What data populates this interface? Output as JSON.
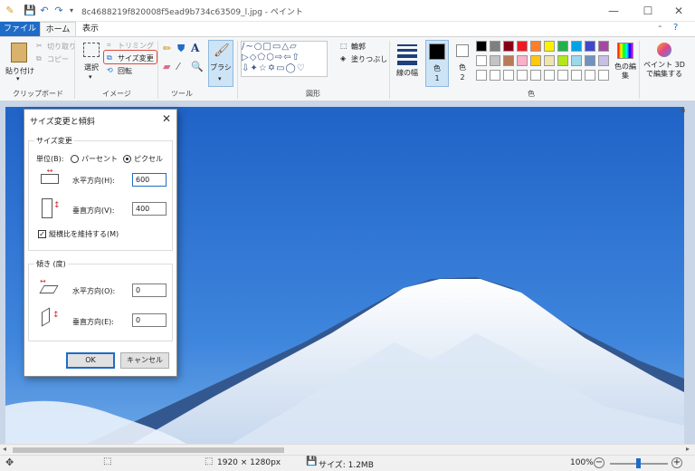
{
  "titlebar": {
    "title": "8c4688219f820008f5ead9b734c63509_l.jpg - ペイント",
    "minimize": "—",
    "maximize": "☐",
    "close": "✕"
  },
  "tabs": {
    "file": "ファイル",
    "home": "ホーム",
    "view": "表示"
  },
  "ribbon": {
    "clipboard": {
      "paste": "貼り付け",
      "cut": "切り取り",
      "copy": "コピー",
      "label": "クリップボード"
    },
    "image": {
      "select": "選択",
      "crop": "トリミング",
      "resize": "サイズ変更",
      "rotate": "回転",
      "label": "イメージ"
    },
    "tools": {
      "label": "ツール"
    },
    "brush": {
      "label": "ブラシ"
    },
    "shapes": {
      "outline": "輪郭",
      "fill": "塗りつぶし",
      "label": "図形"
    },
    "size": {
      "label": "線の幅"
    },
    "color1": {
      "label": "色",
      "num": "1"
    },
    "color2": {
      "label": "色",
      "num": "2"
    },
    "colors": {
      "label": "色"
    },
    "edit_colors": "色の編集",
    "paint3d": "ペイント 3D で編集する",
    "palette_colors": [
      "#000000",
      "#7f7f7f",
      "#880015",
      "#ed1c24",
      "#ff7f27",
      "#fff200",
      "#22b14c",
      "#00a2e8",
      "#3f48cc",
      "#a349a4",
      "#ffffff",
      "#c3c3c3",
      "#b97a57",
      "#ffaec9",
      "#ffc90e",
      "#efe4b0",
      "#b5e61d",
      "#99d9ea",
      "#7092be",
      "#c8bfe7"
    ]
  },
  "dialog": {
    "title": "サイズ変更と傾斜",
    "resize_group": "サイズ変更",
    "unit_label": "単位(B):",
    "percent": "パーセント",
    "pixel": "ピクセル",
    "horizontal_label": "水平方向(H):",
    "horizontal_value": "600",
    "vertical_label": "垂直方向(V):",
    "vertical_value": "400",
    "keep_ratio": "縦横比を維持する(M)",
    "skew_group": "傾き (度)",
    "skew_h_label": "水平方向(O):",
    "skew_h_value": "0",
    "skew_v_label": "垂直方向(E):",
    "skew_v_value": "0",
    "ok": "OK",
    "cancel": "キャンセル"
  },
  "status": {
    "dimensions": "1920 × 1280px",
    "size": "サイズ: 1.2MB",
    "zoom": "100%"
  }
}
